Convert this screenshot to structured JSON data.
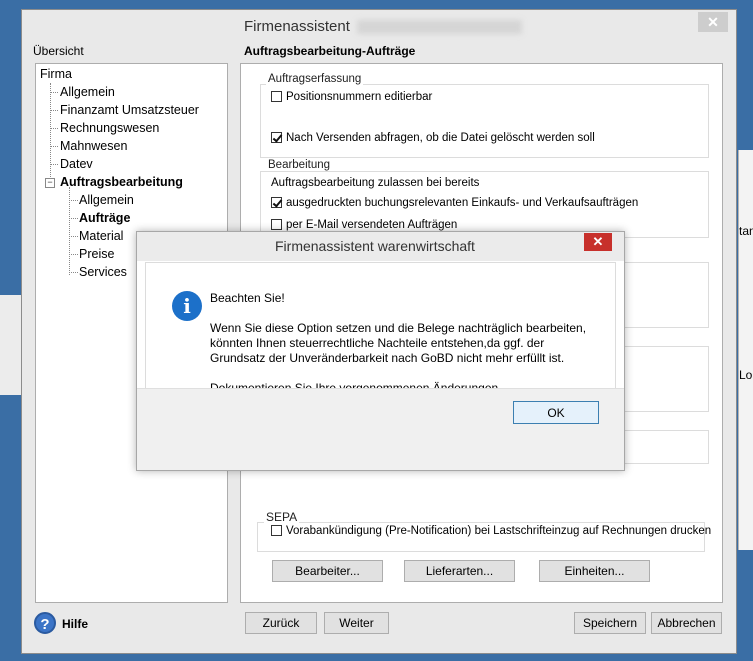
{
  "background": {
    "text_right_1": "tan",
    "text_right_2": "Lo"
  },
  "window": {
    "title": "Firmenassistent",
    "close_glyph": "✕"
  },
  "sidebar": {
    "label": "Übersicht",
    "tree": {
      "root": "Firma",
      "items": [
        "Allgemein",
        "Finanzamt Umsatzsteuer",
        "Rechnungswesen",
        "Mahnwesen",
        "Datev"
      ],
      "expanded": "Auftragsbearbeitung",
      "children": [
        "Allgemein",
        "Aufträge",
        "Material",
        "Preise",
        "Services"
      ],
      "expander_glyph": "−"
    }
  },
  "main": {
    "title": "Auftragsbearbeitung-Aufträge",
    "auftragserfassung": {
      "title": "Auftragserfassung",
      "positionsnummern": "Positionsnummern editierbar",
      "versenden": "Nach Versenden abfragen, ob die Datei gelöscht werden soll"
    },
    "bearbeitung": {
      "title": "Bearbeitung",
      "info": "Auftragsbearbeitung zulassen bei bereits",
      "ausgedruckt": "ausgedruckten buchungsrelevanten Einkaufs- und Verkaufsaufträgen",
      "email": "per E-Mail versendeten Aufträgen"
    },
    "sepa": {
      "title": "SEPA",
      "vorab": "Vorabankündigung (Pre-Notification) bei Lastschrifteinzug auf Rechnungen drucken"
    },
    "buttons": {
      "bearbeiter": "Bearbeiter...",
      "lieferarten": "Lieferarten...",
      "einheiten": "Einheiten..."
    }
  },
  "footer": {
    "help_glyph": "?",
    "help": "Hilfe",
    "back": "Zurück",
    "next": "Weiter",
    "save": "Speichern",
    "cancel": "Abbrechen"
  },
  "dialog": {
    "title": "Firmenassistent warenwirtschaft",
    "close_glyph": "✕",
    "icon_glyph": "i",
    "heading": "Beachten Sie!",
    "line1": "Wenn Sie diese Option setzen und die Belege nachträglich bearbeiten,",
    "line2": "könnten Ihnen steuerrechtliche Nachteile entstehen,da ggf. der",
    "line3": "Grundsatz der Unveränderbarkeit nach GoBD nicht mehr erfüllt ist.",
    "line4": "Dokumentieren Sie Ihre vorgenommenen Änderungen.",
    "ok": "OK"
  }
}
